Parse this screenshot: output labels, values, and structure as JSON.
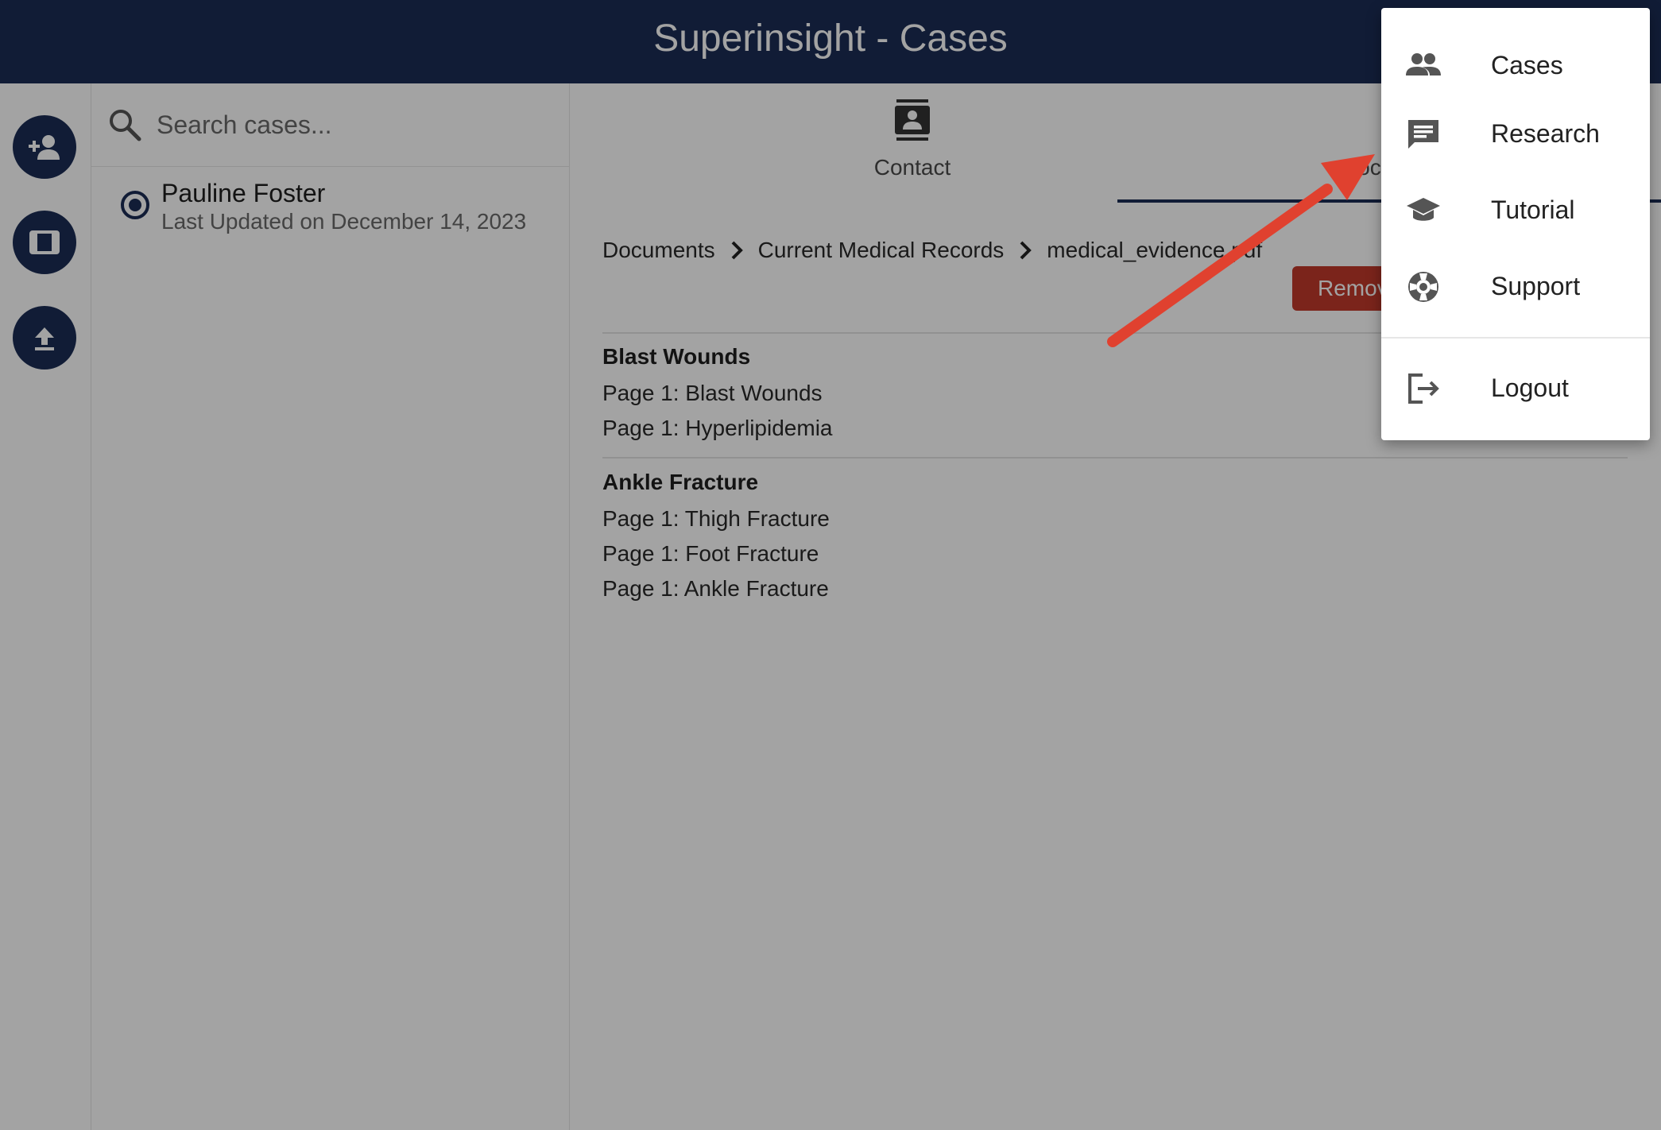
{
  "app": {
    "title": "Superinsight - Cases"
  },
  "rail": {
    "buttons": [
      {
        "icon": "add-user-icon"
      },
      {
        "icon": "panel-icon"
      },
      {
        "icon": "upload-icon"
      }
    ]
  },
  "search": {
    "placeholder": "Search cases..."
  },
  "cases": [
    {
      "name": "Pauline Foster",
      "updated": "Last Updated on December 14, 2023",
      "selected": true
    }
  ],
  "tabs": [
    {
      "label": "Contact",
      "icon": "contact-card-icon"
    },
    {
      "label": "Docu",
      "icon": "document-icon",
      "active": true
    }
  ],
  "breadcrumb": {
    "items": [
      "Documents",
      "Current Medical Records",
      "medical_evidence.pdf"
    ]
  },
  "actions": {
    "remove_label": "Remove F"
  },
  "groups": [
    {
      "title": "Blast Wounds",
      "pages": [
        "Page 1: Blast Wounds",
        "Page 1: Hyperlipidemia"
      ]
    },
    {
      "title": "Ankle Fracture",
      "pages": [
        "Page 1: Thigh Fracture",
        "Page 1: Foot Fracture",
        "Page 1: Ankle Fracture"
      ]
    }
  ],
  "menu": {
    "items": [
      {
        "label": "Cases",
        "icon": "people-icon"
      },
      {
        "label": "Research",
        "icon": "chat-icon",
        "highlighted": true
      },
      {
        "label": "Tutorial",
        "icon": "graduation-cap-icon"
      },
      {
        "label": "Support",
        "icon": "lifebuoy-icon"
      },
      {
        "label": "Logout",
        "icon": "logout-icon"
      }
    ]
  },
  "colors": {
    "header": "#1b2d55",
    "accent": "#1b2d55",
    "danger": "#c0392b",
    "annotation_arrow": "#e0412f"
  }
}
